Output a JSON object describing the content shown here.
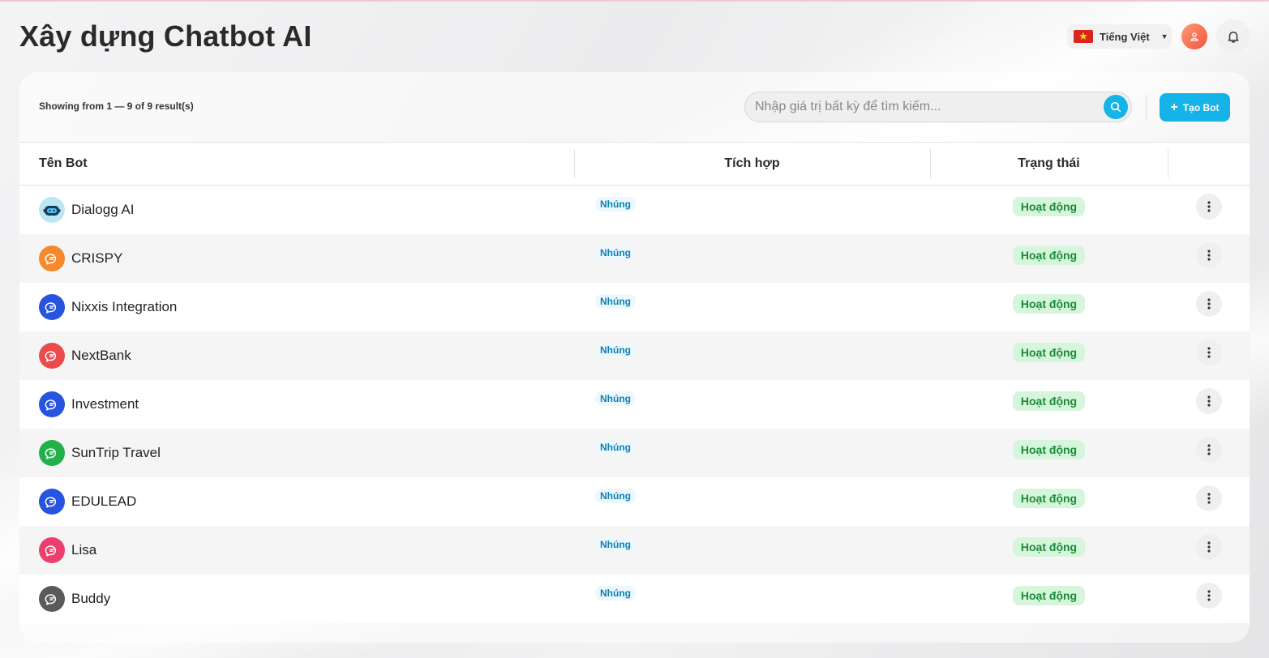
{
  "header": {
    "title": "Xây dựng Chatbot AI",
    "language": {
      "label": "Tiếng Việt",
      "flag_icon": "vietnam-flag-icon"
    },
    "avatar_icon": "user-icon",
    "notification_icon": "bell-icon"
  },
  "toolbar": {
    "showing_text": "Showing from 1 — 9 of 9 result(s)",
    "search_placeholder": "Nhập giá trị bất kỳ để tìm kiếm...",
    "create_label": "Tạo Bot",
    "accent_color": "#16b3e8"
  },
  "table": {
    "columns": [
      "Tên Bot",
      "Tích hợp",
      "Trạng thái",
      ""
    ],
    "rows": [
      {
        "name": "Dialogg AI",
        "integration": "Nhúng",
        "status": "Hoạt động",
        "icon": "robot-avatar-icon",
        "color": "#bde6f3"
      },
      {
        "name": "CRISPY",
        "integration": "Nhúng",
        "status": "Hoạt động",
        "icon": "chat-bubble-icon",
        "color": "#f5892b"
      },
      {
        "name": "Nixxis Integration",
        "integration": "Nhúng",
        "status": "Hoạt động",
        "icon": "chat-bubble-icon",
        "color": "#2653e0"
      },
      {
        "name": "NextBank",
        "integration": "Nhúng",
        "status": "Hoạt động",
        "icon": "chat-bubble-icon",
        "color": "#ec4b4b"
      },
      {
        "name": "Investment",
        "integration": "Nhúng",
        "status": "Hoạt động",
        "icon": "chat-bubble-icon",
        "color": "#2653e0"
      },
      {
        "name": "SunTrip Travel",
        "integration": "Nhúng",
        "status": "Hoạt động",
        "icon": "chat-bubble-icon",
        "color": "#22b04a"
      },
      {
        "name": "EDULEAD",
        "integration": "Nhúng",
        "status": "Hoạt động",
        "icon": "chat-bubble-icon",
        "color": "#2653e0"
      },
      {
        "name": "Lisa",
        "integration": "Nhúng",
        "status": "Hoạt động",
        "icon": "chat-bubble-icon",
        "color": "#ec3f6b"
      },
      {
        "name": "Buddy",
        "integration": "Nhúng",
        "status": "Hoạt động",
        "icon": "chat-bubble-icon",
        "color": "#5a5a5a"
      }
    ]
  }
}
